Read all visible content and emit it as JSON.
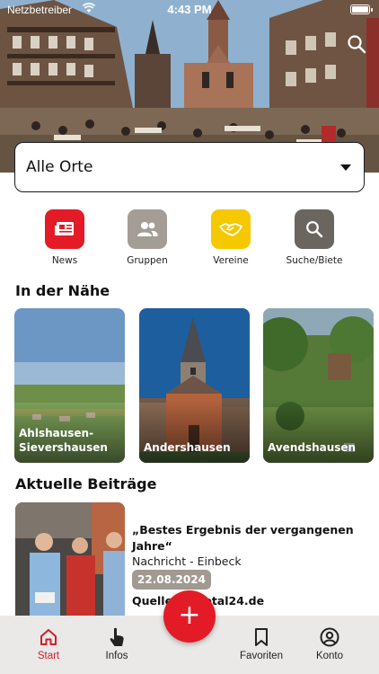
{
  "status_bar": {
    "carrier": "Netzbetreiber",
    "time": "4:43 PM"
  },
  "hero": {
    "search_icon": "search-icon"
  },
  "location": {
    "selected": "Alle Orte"
  },
  "categories": [
    {
      "label": "News",
      "icon": "newspaper-icon",
      "color": "#e31b26"
    },
    {
      "label": "Gruppen",
      "icon": "group-icon",
      "color": "#a49d95"
    },
    {
      "label": "Vereine",
      "icon": "handshake-icon",
      "color": "#f5c800"
    },
    {
      "label": "Suche/Biete",
      "icon": "search-icon",
      "color": "#6b6560"
    }
  ],
  "nearby": {
    "title": "In der Nähe",
    "places": [
      {
        "name": "Ahlshausen-\nSievershausen"
      },
      {
        "name": "Andershausen"
      },
      {
        "name": "Avendshausen"
      }
    ]
  },
  "articles": {
    "title": "Aktuelle Beiträge",
    "items": [
      {
        "title": "„Bestes Ergebnis der vergangenen Jahre“",
        "meta": "Nachricht - Einbeck",
        "date": "22.08.2024",
        "source": "Quelle: leinetal24.de"
      }
    ]
  },
  "fab": {
    "label": "+"
  },
  "nav": {
    "items": [
      {
        "label": "Start",
        "icon": "home-icon",
        "active": true
      },
      {
        "label": "Infos",
        "icon": "tap-icon",
        "active": false
      },
      {
        "label": "Favoriten",
        "icon": "bookmark-icon",
        "active": false
      },
      {
        "label": "Konto",
        "icon": "account-icon",
        "active": false
      }
    ]
  },
  "colors": {
    "accent": "#e31b26",
    "nav_background": "#eae9e7",
    "date_badge": "#a09a92"
  }
}
